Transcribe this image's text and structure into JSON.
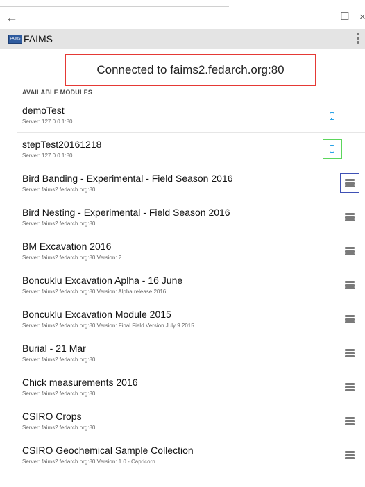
{
  "window": {
    "back_glyph": "←",
    "minimize_glyph": "_",
    "maximize_glyph": "☐",
    "close_glyph": "×"
  },
  "app": {
    "logo_text": "FAIMS",
    "title": "FAIMS"
  },
  "banner": "Connected to faims2.fedarch.org:80",
  "section_label": "AVAILABLE MODULES",
  "modules": [
    {
      "title": "demoTest",
      "subtitle": "Server: 127.0.0.1:80",
      "icon": "phone-icon"
    },
    {
      "title": "stepTest20161218",
      "subtitle": "Server: 127.0.0.1:80",
      "icon": "phone-icon"
    },
    {
      "title": "Bird Banding - Experimental - Field Season 2016",
      "subtitle": "Server: faims2.fedarch.org:80",
      "icon": "server-icon"
    },
    {
      "title": "Bird Nesting - Experimental - Field Season 2016",
      "subtitle": "Server: faims2.fedarch.org:80",
      "icon": "server-icon"
    },
    {
      "title": "BM Excavation 2016",
      "subtitle": "Server: faims2.fedarch.org:80 Version: 2",
      "icon": "server-icon"
    },
    {
      "title": "Boncuklu Excavation Aplha - 16 June",
      "subtitle": "Server: faims2.fedarch.org:80 Version: Alpha release 2016",
      "icon": "server-icon"
    },
    {
      "title": "Boncuklu Excavation Module 2015",
      "subtitle": "Server: faims2.fedarch.org:80 Version: Final Field Version July 9 2015",
      "icon": "server-icon"
    },
    {
      "title": "Burial - 21 Mar",
      "subtitle": "Server: faims2.fedarch.org:80",
      "icon": "server-icon"
    },
    {
      "title": "Chick measurements 2016",
      "subtitle": "Server: faims2.fedarch.org:80",
      "icon": "server-icon"
    },
    {
      "title": "CSIRO Crops",
      "subtitle": "Server: faims2.fedarch.org:80",
      "icon": "server-icon"
    },
    {
      "title": "CSIRO Geochemical Sample Collection",
      "subtitle": "Server: faims2.fedarch.org:80 Version: 1.0 - Capricorn",
      "icon": "server-icon"
    }
  ],
  "colors": {
    "phone_icon": "#29a3e6",
    "server_icon": "#7a7a7a",
    "banner_border": "#e53935",
    "highlight_green": "#5cd65c",
    "highlight_blue": "#3f51b5"
  }
}
